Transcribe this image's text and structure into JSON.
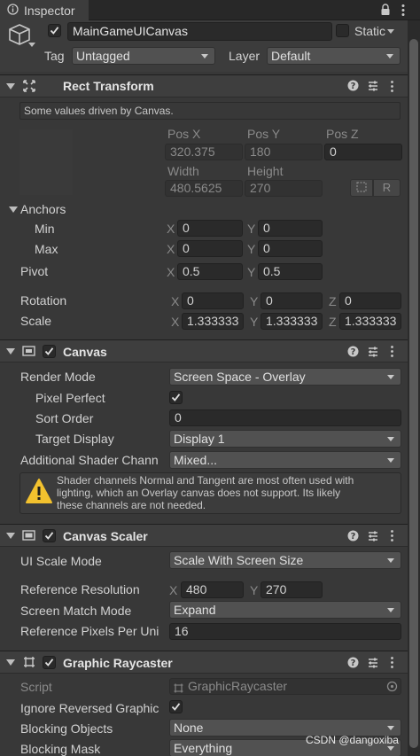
{
  "tab": {
    "title": "Inspector"
  },
  "object": {
    "name": "MainGameUICanvas",
    "static_label": "Static",
    "tag_label": "Tag",
    "tag_value": "Untagged",
    "layer_label": "Layer",
    "layer_value": "Default"
  },
  "rect_transform": {
    "title": "Rect Transform",
    "info": "Some values driven by Canvas.",
    "pos_x_label": "Pos X",
    "pos_y_label": "Pos Y",
    "pos_z_label": "Pos Z",
    "pos_x": "320.375",
    "pos_y": "180",
    "pos_z": "0",
    "width_label": "Width",
    "height_label": "Height",
    "width": "480.5625",
    "height": "270",
    "r_button": "R",
    "anchors_label": "Anchors",
    "min_label": "Min",
    "max_label": "Max",
    "min_x": "0",
    "min_y": "0",
    "max_x": "0",
    "max_y": "0",
    "pivot_label": "Pivot",
    "pivot_x": "0.5",
    "pivot_y": "0.5",
    "rotation_label": "Rotation",
    "rot_x": "0",
    "rot_y": "0",
    "rot_z": "0",
    "scale_label": "Scale",
    "scale_x": "1.333333",
    "scale_y": "1.333333",
    "scale_z": "1.333333",
    "x": "X",
    "y": "Y",
    "z": "Z"
  },
  "canvas": {
    "title": "Canvas",
    "render_mode_label": "Render Mode",
    "render_mode": "Screen Space - Overlay",
    "pixel_perfect_label": "Pixel Perfect",
    "sort_order_label": "Sort Order",
    "sort_order": "0",
    "target_display_label": "Target Display",
    "target_display": "Display 1",
    "shader_label": "Additional Shader Chann",
    "shader_value": "Mixed...",
    "warning_line1": "Shader channels Normal and Tangent are most often used with",
    "warning_line2": "lighting, which an Overlay canvas does not support. Its likely",
    "warning_line3": "these channels are not needed."
  },
  "canvas_scaler": {
    "title": "Canvas Scaler",
    "ui_scale_mode_label": "UI Scale Mode",
    "ui_scale_mode": "Scale With Screen Size",
    "ref_res_label": "Reference Resolution",
    "ref_x": "480",
    "ref_y": "270",
    "match_mode_label": "Screen Match Mode",
    "match_mode": "Expand",
    "ref_ppu_label": "Reference Pixels Per Uni",
    "ref_ppu": "16"
  },
  "raycaster": {
    "title": "Graphic Raycaster",
    "script_label": "Script",
    "script_value": "GraphicRaycaster",
    "ignore_label": "Ignore Reversed Graphic",
    "blocking_objects_label": "Blocking Objects",
    "blocking_objects": "None",
    "blocking_mask_label": "Blocking Mask",
    "blocking_mask": "Everything"
  },
  "watermark": "CSDN @dangoxiba",
  "colors": {
    "background": "#383838",
    "header": "#3e3e3e",
    "field": "#2a2a2a",
    "dropdown": "#515151",
    "warning": "#f2c12e"
  }
}
